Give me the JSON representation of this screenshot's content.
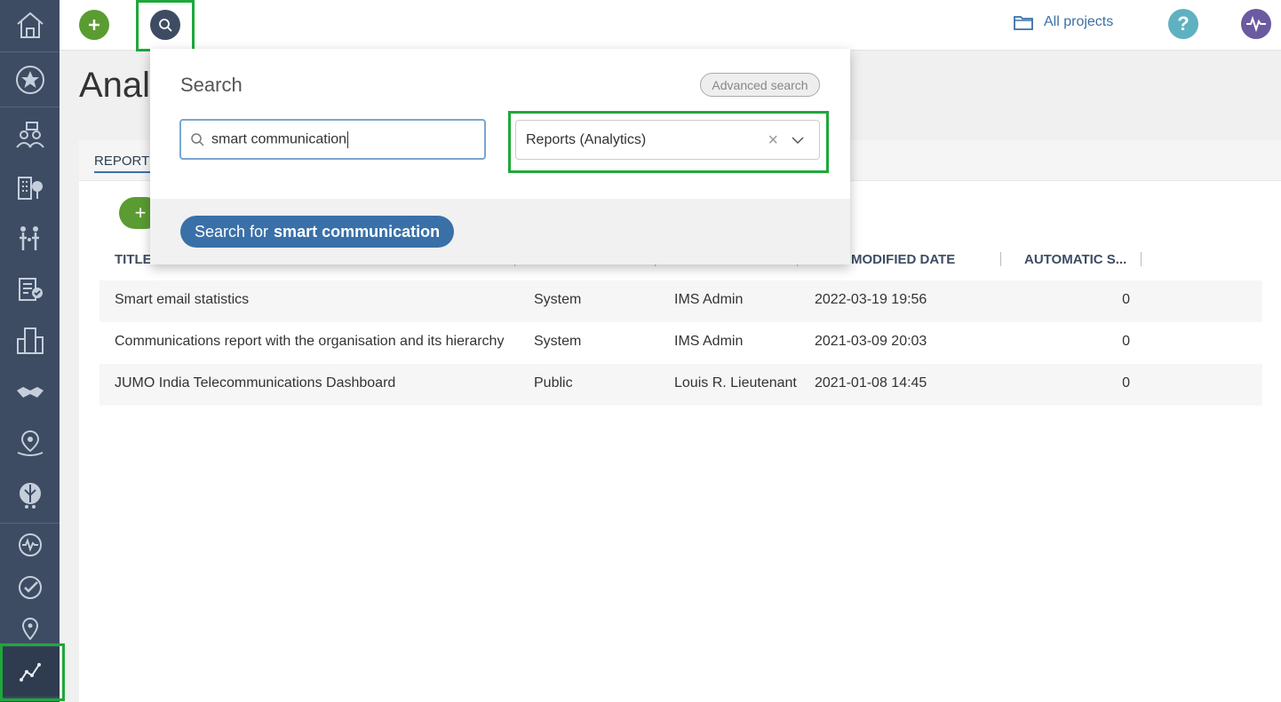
{
  "sidebar": {
    "icons": [
      "home-icon",
      "star-icon",
      "people-chat-icon",
      "buildings-tree-icon",
      "family-icon",
      "checklist-icon",
      "city-icon",
      "handshake-icon",
      "map-pin-icon",
      "leaf-drops-icon",
      "activity-icon",
      "check-circle-icon",
      "location-icon",
      "analytics-icon"
    ],
    "active": "analytics-icon"
  },
  "topbar": {
    "projects_label": "All projects",
    "help_label": "?"
  },
  "page": {
    "title": "Analy"
  },
  "tabs": {
    "reports_label": "REPORTS"
  },
  "table": {
    "headers": [
      "TITLE",
      "MODIFIED DATE",
      "AUTOMATIC S..."
    ],
    "rows": [
      [
        "Smart email statistics",
        "System",
        "IMS Admin",
        "2022-03-19 19:56",
        "0"
      ],
      [
        "Communications report with the organisation and its hierarchy",
        "System",
        "IMS Admin",
        "2021-03-09 20:03",
        "0"
      ],
      [
        "JUMO India Telecommunications Dashboard",
        "Public",
        "Louis R. Lieutenant",
        "2021-01-08 14:45",
        "0"
      ]
    ]
  },
  "search": {
    "title": "Search",
    "advanced_label": "Advanced search",
    "query": "smart communication",
    "scope": "Reports (Analytics)",
    "button_prefix": "Search for",
    "button_query": "smart communication"
  },
  "colors": {
    "sidebar": "#3d4c63",
    "highlight": "#1fa83a",
    "primary": "#3a70a8",
    "add_green": "#5a9c32"
  }
}
